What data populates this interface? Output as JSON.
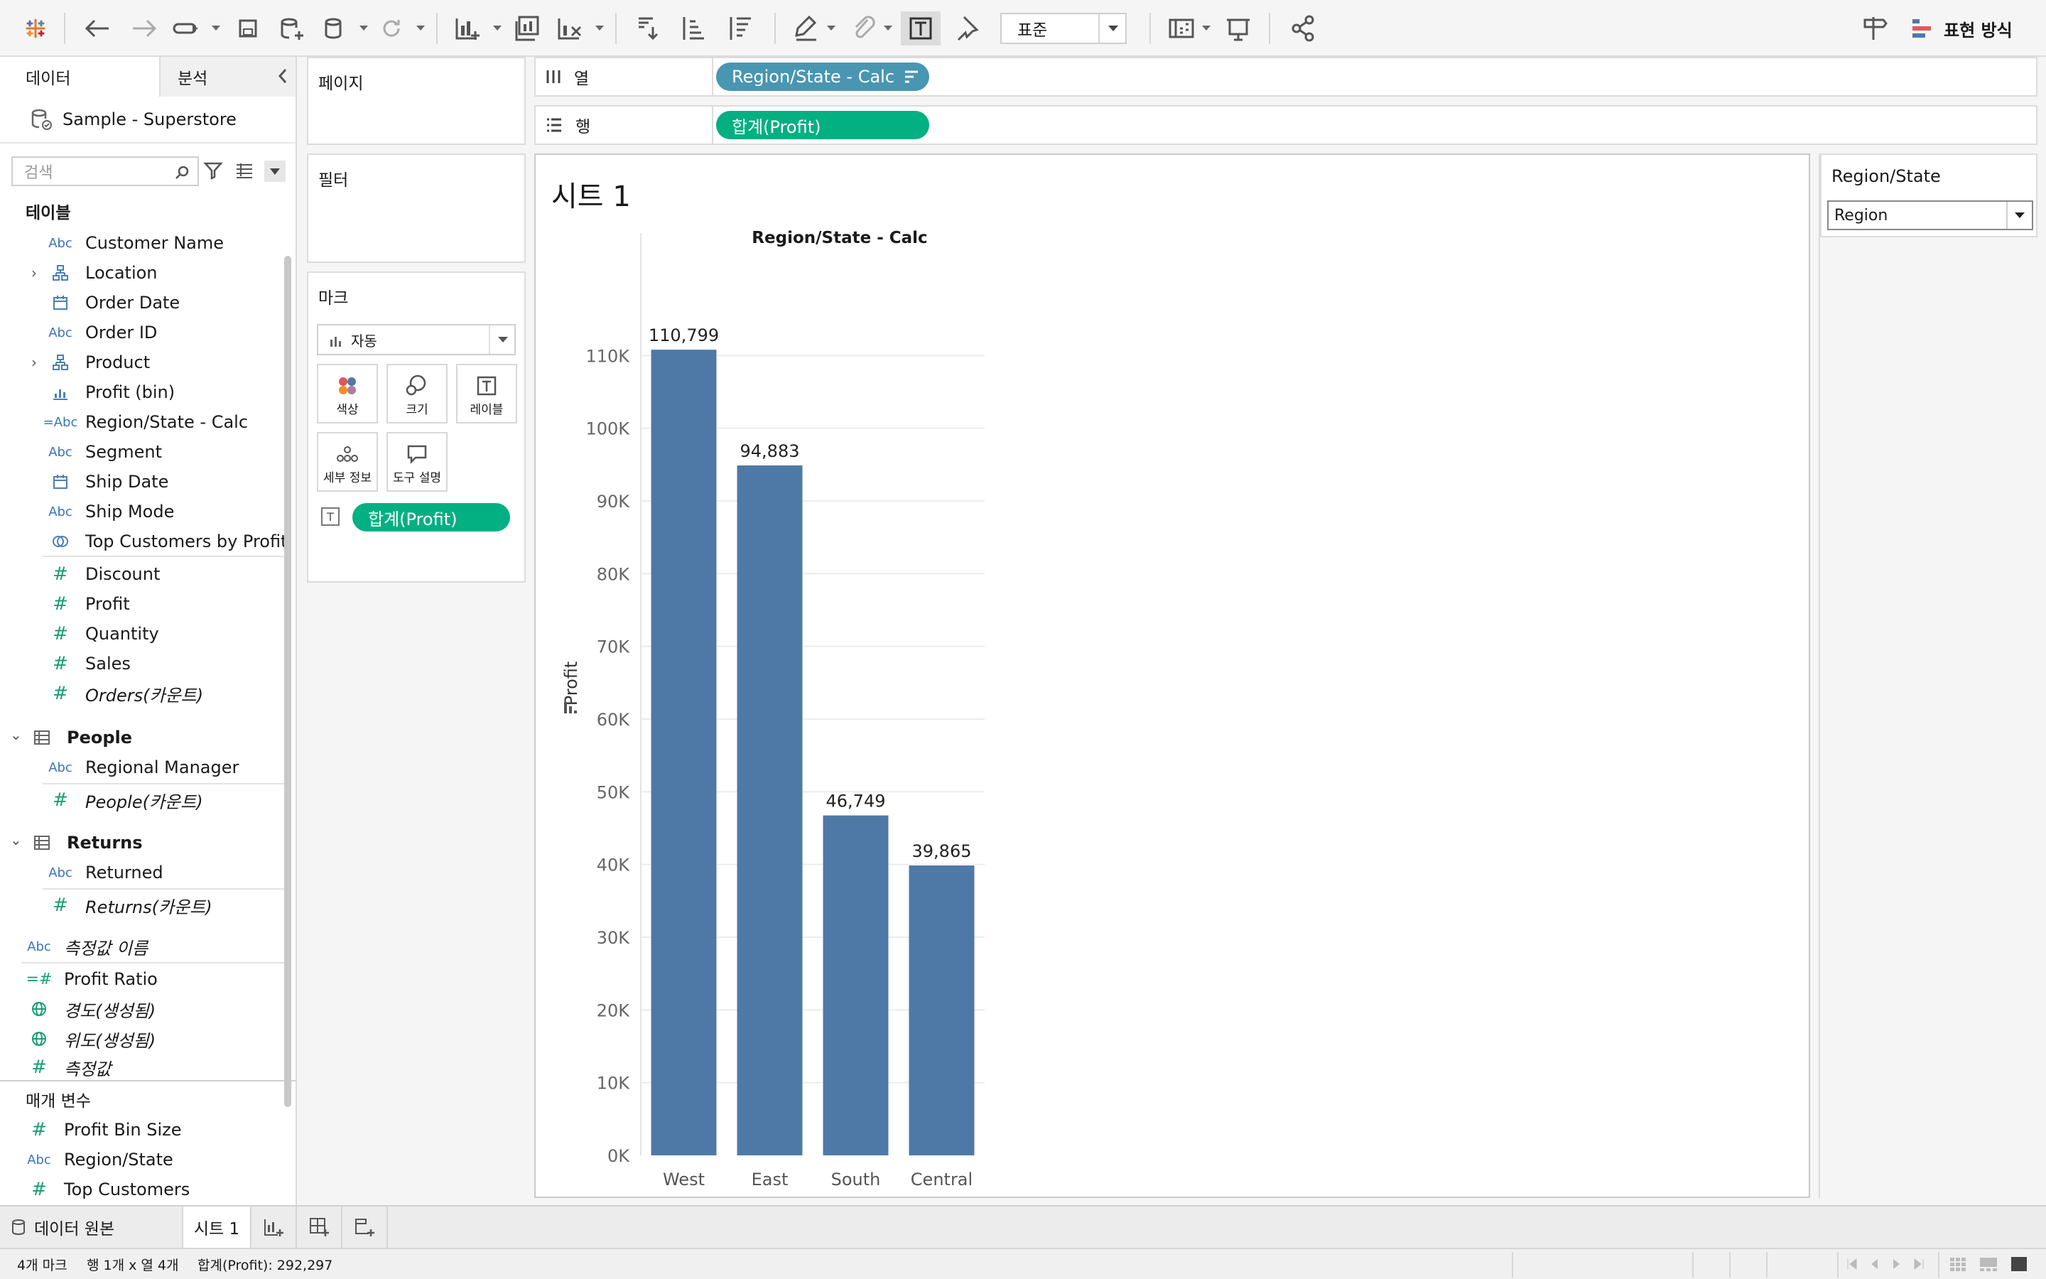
{
  "toolbar": {
    "fit_value": "표준",
    "show_me_label": "표현 방식"
  },
  "data_pane": {
    "tabs": {
      "data": "데이터",
      "analytics": "분석"
    },
    "datasource": "Sample - Superstore",
    "search_placeholder": "검색",
    "tables_header": "테이블",
    "orders_fields": [
      {
        "label": "Customer Name",
        "icon": "abc-icon"
      },
      {
        "label": "Location",
        "icon": "hierarchy-icon"
      },
      {
        "label": "Order Date",
        "icon": "calendar-icon"
      },
      {
        "label": "Order ID",
        "icon": "abc-icon"
      },
      {
        "label": "Product",
        "icon": "hierarchy-icon"
      },
      {
        "label": "Profit (bin)",
        "icon": "bin-icon"
      },
      {
        "label": "Region/State - Calc",
        "icon": "calc-abc-icon"
      },
      {
        "label": "Segment",
        "icon": "abc-icon"
      },
      {
        "label": "Ship Date",
        "icon": "calendar-icon"
      },
      {
        "label": "Ship Mode",
        "icon": "abc-icon"
      },
      {
        "label": "Top Customers by Profit",
        "icon": "set-icon"
      }
    ],
    "orders_measures": [
      "Discount",
      "Profit",
      "Quantity",
      "Sales",
      "Orders(카운트)"
    ],
    "people": {
      "title": "People",
      "fields": [
        "Regional Manager",
        "People(카운트)"
      ]
    },
    "returns": {
      "title": "Returns",
      "fields": [
        "Returned",
        "Returns(카운트)"
      ]
    },
    "misc_fields": [
      "측정값 이름",
      "Profit Ratio",
      "경도(생성됨)",
      "위도(생성됨)",
      "측정값"
    ],
    "params_header": "매개 변수",
    "params": [
      "Profit Bin Size",
      "Region/State",
      "Top Customers"
    ]
  },
  "cards": {
    "pages": "페이지",
    "filters": "필터",
    "marks": "마크",
    "mark_type": "자동",
    "buttons": {
      "color": "색상",
      "size": "크기",
      "label": "레이블",
      "detail": "세부 정보",
      "tooltip": "도구 설명"
    },
    "text_pill": "합계(Profit)"
  },
  "shelves": {
    "columns_label": "열",
    "rows_label": "행",
    "columns_pill": "Region/State - Calc",
    "rows_pill": "합계(Profit)"
  },
  "view": {
    "sheet_title": "시트 1"
  },
  "chart_data": {
    "type": "bar",
    "title": "Region/State - Calc",
    "categories": [
      "West",
      "East",
      "South",
      "Central"
    ],
    "values": [
      110799,
      94883,
      46749,
      39865
    ],
    "labels": [
      "110,799",
      "94,883",
      "46,749",
      "39,865"
    ],
    "ylabel": "Profit",
    "ylim": [
      0,
      120000
    ],
    "yticks": [
      0,
      10000,
      20000,
      30000,
      40000,
      50000,
      60000,
      70000,
      80000,
      90000,
      100000,
      110000
    ],
    "ytick_labels": [
      "0K",
      "10K",
      "20K",
      "30K",
      "40K",
      "50K",
      "60K",
      "70K",
      "80K",
      "90K",
      "100K",
      "110K"
    ],
    "bar_color": "#4e79a7",
    "grid": true
  },
  "parameter": {
    "title": "Region/State",
    "value": "Region"
  },
  "sheet_tabs": {
    "datasource": "데이터 원본",
    "sheet1": "시트 1"
  },
  "status": {
    "marks": "4개 마크",
    "rows_cols": "행 1개 x 열 4개",
    "sum": "합계(Profit): 292,297"
  }
}
